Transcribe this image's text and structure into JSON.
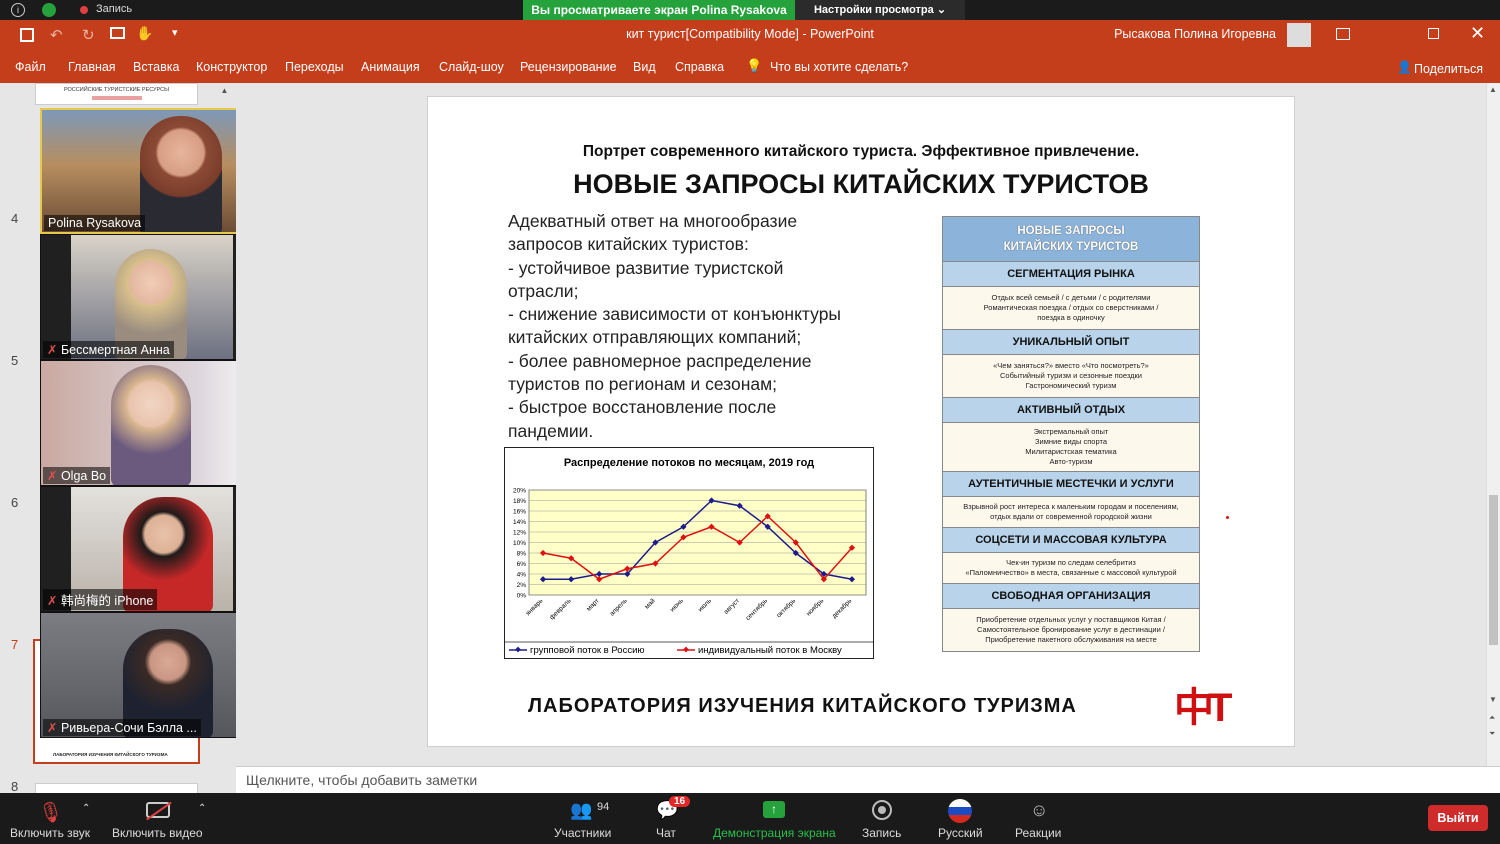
{
  "zoom_top": {
    "record_label": "Запись",
    "share_banner": "Вы просматриваете экран Polina Rysakova",
    "view_options": "Настройки просмотра ⌄"
  },
  "ppt": {
    "window_title": "кит турист[Compatibility Mode]  -  PowerPoint",
    "user_name": "Рысакова Полина Игоревна",
    "tabs": [
      "Файл",
      "Главная",
      "Вставка",
      "Конструктор",
      "Переходы",
      "Анимация",
      "Слайд-шоу",
      "Рецензирование",
      "Вид",
      "Справка"
    ],
    "tell_me": "Что вы хотите сделать?",
    "share": "Поделиться"
  },
  "thumbs": {
    "numbers": [
      "4",
      "5",
      "6",
      "7",
      "8"
    ],
    "thumb_top_text": "РОССИЙСКИЕ ТУРИСТСКИЕ РЕСУРСЫ",
    "thumb7_footer": "ЛАБОРАТОРИЯ ИЗУЧЕНИЯ КИТАЙСКОГО ТУРИЗМА"
  },
  "participants_video": [
    {
      "name": "Polina Rysakova",
      "muted": false
    },
    {
      "name": "Бессмертная Анна",
      "muted": true
    },
    {
      "name": "Olga Bo",
      "muted": true
    },
    {
      "name": "韩尚梅的 iPhone",
      "muted": true
    },
    {
      "name": "Ривьера-Сочи Бэлла ...",
      "muted": true
    }
  ],
  "slide": {
    "subtitle": "Портрет современного китайского туриста. Эффективное привлечение.",
    "title": "НОВЫЕ ЗАПРОСЫ КИТАЙСКИХ ТУРИСТОВ",
    "body_lines": [
      "Адекватный ответ на многообразие",
      "запросов китайских туристов:",
      "- устойчивое развитие туристской",
      "отрасли;",
      "- снижение зависимости от конъюнктуры",
      "китайских отправляющих компаний;",
      "- более равномерное распределение",
      "туристов по регионам и сезонам;",
      "- быстрое восстановление после",
      "пандемии."
    ],
    "box_title": [
      "НОВЫЕ ЗАПРОСЫ",
      "КИТАЙСКИХ ТУРИСТОВ"
    ],
    "sections": [
      {
        "head": "СЕГМЕНТАЦИЯ РЫНКА",
        "lines": [
          "Отдых всей семьей / с детьми / с родителями",
          "Романтическая поездка / отдых со сверстниками /",
          "поездка в одиночку"
        ]
      },
      {
        "head": "УНИКАЛЬНЫЙ ОПЫТ",
        "lines": [
          "«Чем заняться?» вместо «Что посмотреть?»",
          "Событийный туризм и сезонные поездки",
          "Гастрономический туризм"
        ]
      },
      {
        "head": "АКТИВНЫЙ ОТДЫХ",
        "lines": [
          "Экстремальный опыт",
          "Зимние виды спорта",
          "Милитаристская тематика",
          "Авто-туризм"
        ]
      },
      {
        "head": "АУТЕНТИЧНЫЕ МЕСТЕЧКИ И УСЛУГИ",
        "lines": [
          "Взрывной рост интереса к маленьким городам и поселениям,",
          "отдых вдали от современной городской жизни"
        ]
      },
      {
        "head": "СОЦСЕТИ И МАССОВАЯ КУЛЬТУРА",
        "lines": [
          "Чек-ин туризм по следам селебритиз",
          "«Паломничество» в места, связанные с массовой культурой"
        ]
      },
      {
        "head": "СВОБОДНАЯ ОРГАНИЗАЦИЯ",
        "lines": [
          "Приобретение отдельных услуг у поставщиков Китая /",
          "Самостоятельное бронирование услуг в дестинации /",
          "Приобретение пакетного обслуживания на месте"
        ]
      }
    ],
    "footer": "ЛАБОРАТОРИЯ ИЗУЧЕНИЯ КИТАЙСКОГО ТУРИЗМА",
    "logo_text": "中T"
  },
  "chart_data": {
    "type": "line",
    "title": "Распределение потоков по месяцам, 2019 год",
    "categories": [
      "январь",
      "февраль",
      "март",
      "апрель",
      "май",
      "июнь",
      "июль",
      "август",
      "сентябрь",
      "октябрь",
      "ноябрь",
      "декабрь"
    ],
    "y_ticks": [
      "0%",
      "2%",
      "4%",
      "6%",
      "8%",
      "10%",
      "12%",
      "14%",
      "16%",
      "18%",
      "20%"
    ],
    "ylim": [
      0,
      20
    ],
    "series": [
      {
        "name": "групповой поток в Россию",
        "color": "#1c1c8c",
        "values": [
          3,
          3,
          4,
          4,
          10,
          13,
          18,
          17,
          13,
          8,
          4,
          3
        ]
      },
      {
        "name": "индивидуальный поток в Москву",
        "color": "#e01010",
        "values": [
          8,
          7,
          3,
          5,
          6,
          11,
          13,
          10,
          15,
          10,
          3,
          9
        ]
      }
    ]
  },
  "notes": {
    "placeholder": "Щелкните, чтобы добавить заметки"
  },
  "zoom_bottom": {
    "mute": "Включить звук",
    "video": "Включить видео",
    "participants": "Участники",
    "participants_count": "94",
    "chat": "Чат",
    "chat_badge": "16",
    "share": "Демонстрация экрана",
    "record": "Запись",
    "language": "Русский",
    "reactions": "Реакции",
    "leave": "Выйти"
  }
}
